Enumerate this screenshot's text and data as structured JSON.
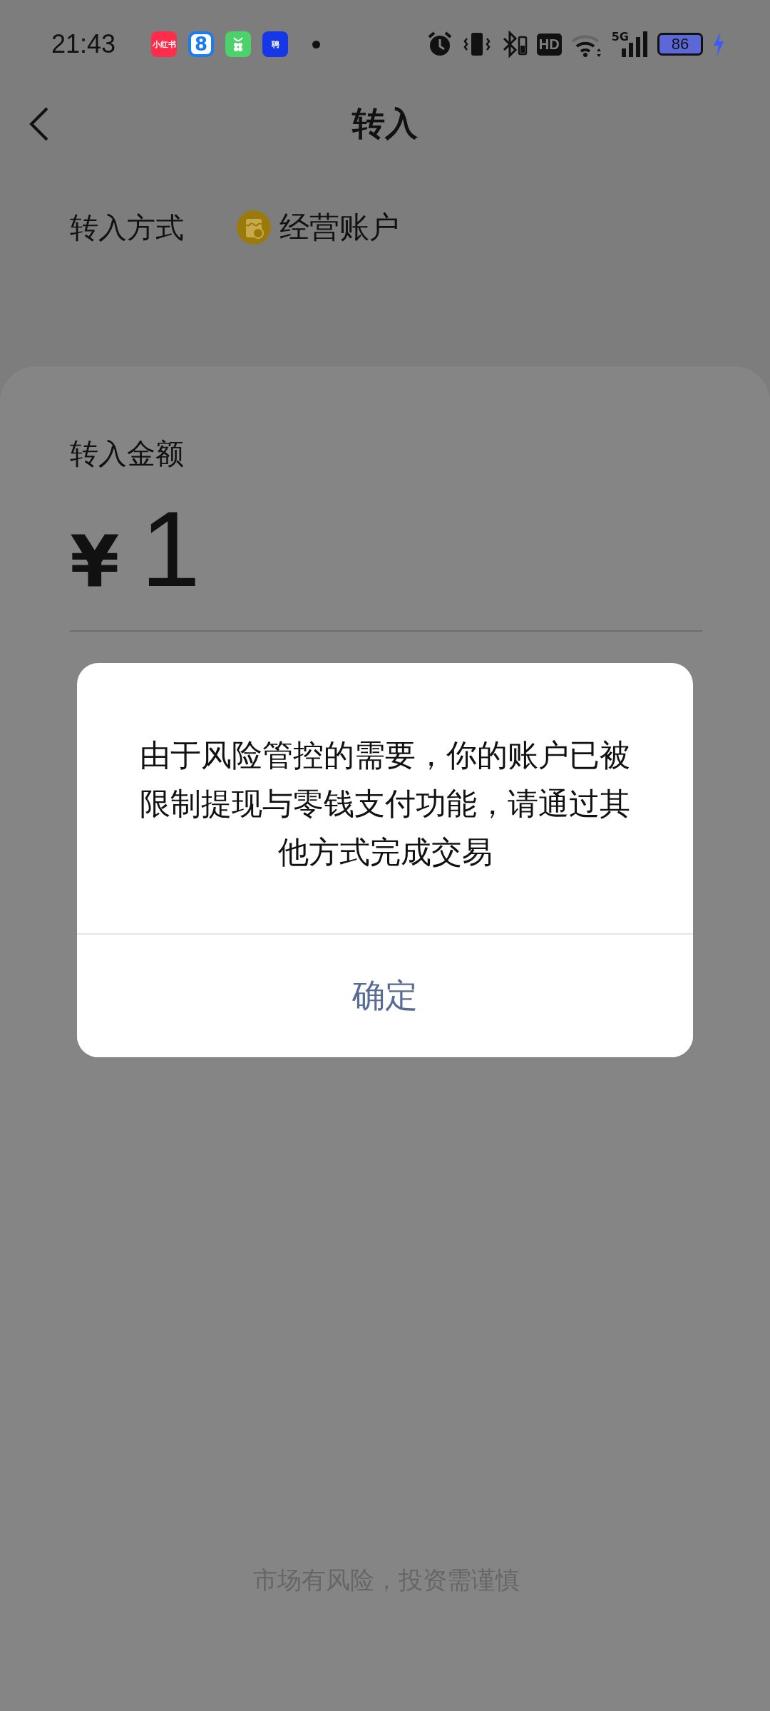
{
  "status_bar": {
    "time": "21:43",
    "notifications": [
      {
        "kind": "text",
        "label": "小红书",
        "color": "#ff2d4b"
      },
      {
        "kind": "ring",
        "label": "8",
        "color": "#1a7cf0"
      },
      {
        "kind": "bag",
        "color": "#4cd26a"
      },
      {
        "kind": "text",
        "label": "聘",
        "color": "#1637e6"
      }
    ],
    "hd": "HD",
    "network": "5G",
    "battery": "86",
    "charging": true
  },
  "header": {
    "title": "转入"
  },
  "transfer_method": {
    "label": "转入方式",
    "account": "经营账户"
  },
  "amount": {
    "label": "转入金额",
    "currency": "¥",
    "value": "1"
  },
  "dialog": {
    "message": "由于风险管控的需要，你的账户已被限制提现与零钱支付功能，请通过其他方式完成交易",
    "button": "确定"
  },
  "footer": "市场有风险，投资需谨慎"
}
